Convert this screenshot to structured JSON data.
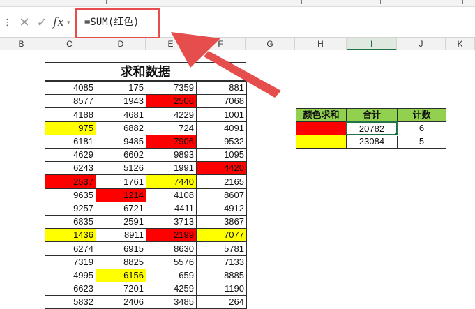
{
  "formula_bar": {
    "formula": "=SUM(红色)",
    "fx_label": "fx",
    "cancel_symbol": "✕",
    "confirm_symbol": "✓"
  },
  "column_headers": [
    "B",
    "C",
    "D",
    "E",
    "F",
    "G",
    "H",
    "I",
    "J",
    "K"
  ],
  "active_column": "I",
  "table": {
    "title": "求和数据",
    "rows": [
      [
        4085,
        175,
        7359,
        881
      ],
      [
        8577,
        1943,
        2506,
        7068
      ],
      [
        4188,
        4681,
        4229,
        1001
      ],
      [
        975,
        6882,
        724,
        4091
      ],
      [
        6181,
        9485,
        7906,
        9532
      ],
      [
        4629,
        6602,
        9893,
        1095
      ],
      [
        6243,
        5126,
        1991,
        4420
      ],
      [
        2537,
        1761,
        7440,
        2165
      ],
      [
        9635,
        1214,
        4108,
        8607
      ],
      [
        9257,
        6721,
        4411,
        4912
      ],
      [
        6835,
        2591,
        3713,
        3867
      ],
      [
        1436,
        8911,
        2199,
        7077
      ],
      [
        6274,
        6915,
        8630,
        5781
      ],
      [
        7319,
        8825,
        5576,
        7133
      ],
      [
        4995,
        6156,
        659,
        8885
      ],
      [
        6623,
        7201,
        4259,
        1190
      ],
      [
        5832,
        2406,
        3485,
        264
      ]
    ],
    "cell_colors": [
      [
        "",
        "",
        "",
        ""
      ],
      [
        "",
        "",
        "red",
        ""
      ],
      [
        "",
        "",
        "",
        ""
      ],
      [
        "yellow",
        "",
        "",
        ""
      ],
      [
        "",
        "",
        "red",
        ""
      ],
      [
        "",
        "",
        "",
        ""
      ],
      [
        "",
        "",
        "",
        "red"
      ],
      [
        "red",
        "",
        "yellow",
        ""
      ],
      [
        "",
        "red",
        "",
        ""
      ],
      [
        "",
        "",
        "",
        ""
      ],
      [
        "",
        "",
        "",
        ""
      ],
      [
        "yellow",
        "",
        "red",
        "yellow"
      ],
      [
        "",
        "",
        "",
        ""
      ],
      [
        "",
        "",
        "",
        ""
      ],
      [
        "",
        "yellow",
        "",
        ""
      ],
      [
        "",
        "",
        "",
        ""
      ],
      [
        "",
        "",
        "",
        ""
      ]
    ]
  },
  "summary": {
    "headers": [
      "颜色求和",
      "合计",
      "计数"
    ],
    "rows": [
      {
        "color": "red",
        "total": "20782",
        "count": "6"
      },
      {
        "color": "yellow",
        "total": "23084",
        "count": "5"
      }
    ]
  },
  "colors": {
    "red": "#ff0000",
    "yellow": "#ffff00",
    "header_green": "#92d050",
    "annotation_red": "#e64e4e",
    "selection_green": "#217346"
  },
  "icons": {
    "cancel": "close-icon",
    "confirm": "check-icon",
    "function": "fx-icon",
    "annotation": "arrow-icon"
  }
}
